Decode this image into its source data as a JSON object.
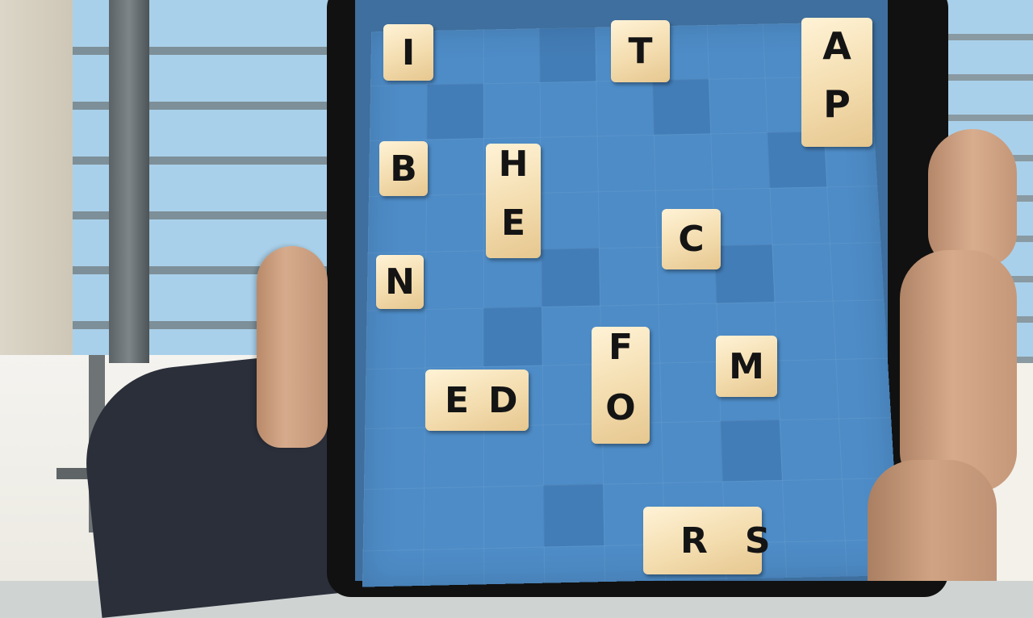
{
  "tiles": [
    {
      "letters": "I"
    },
    {
      "letters": "T"
    },
    {
      "letters": "AP"
    },
    {
      "letters": "B"
    },
    {
      "letters": "HE"
    },
    {
      "letters": "C"
    },
    {
      "letters": "N"
    },
    {
      "letters": "FO"
    },
    {
      "letters": "M"
    },
    {
      "letters": "ED"
    },
    {
      "letters": "RS"
    }
  ],
  "colors": {
    "board": "#4e8cc7",
    "tile": "#f3dcae",
    "letter": "#141414"
  }
}
